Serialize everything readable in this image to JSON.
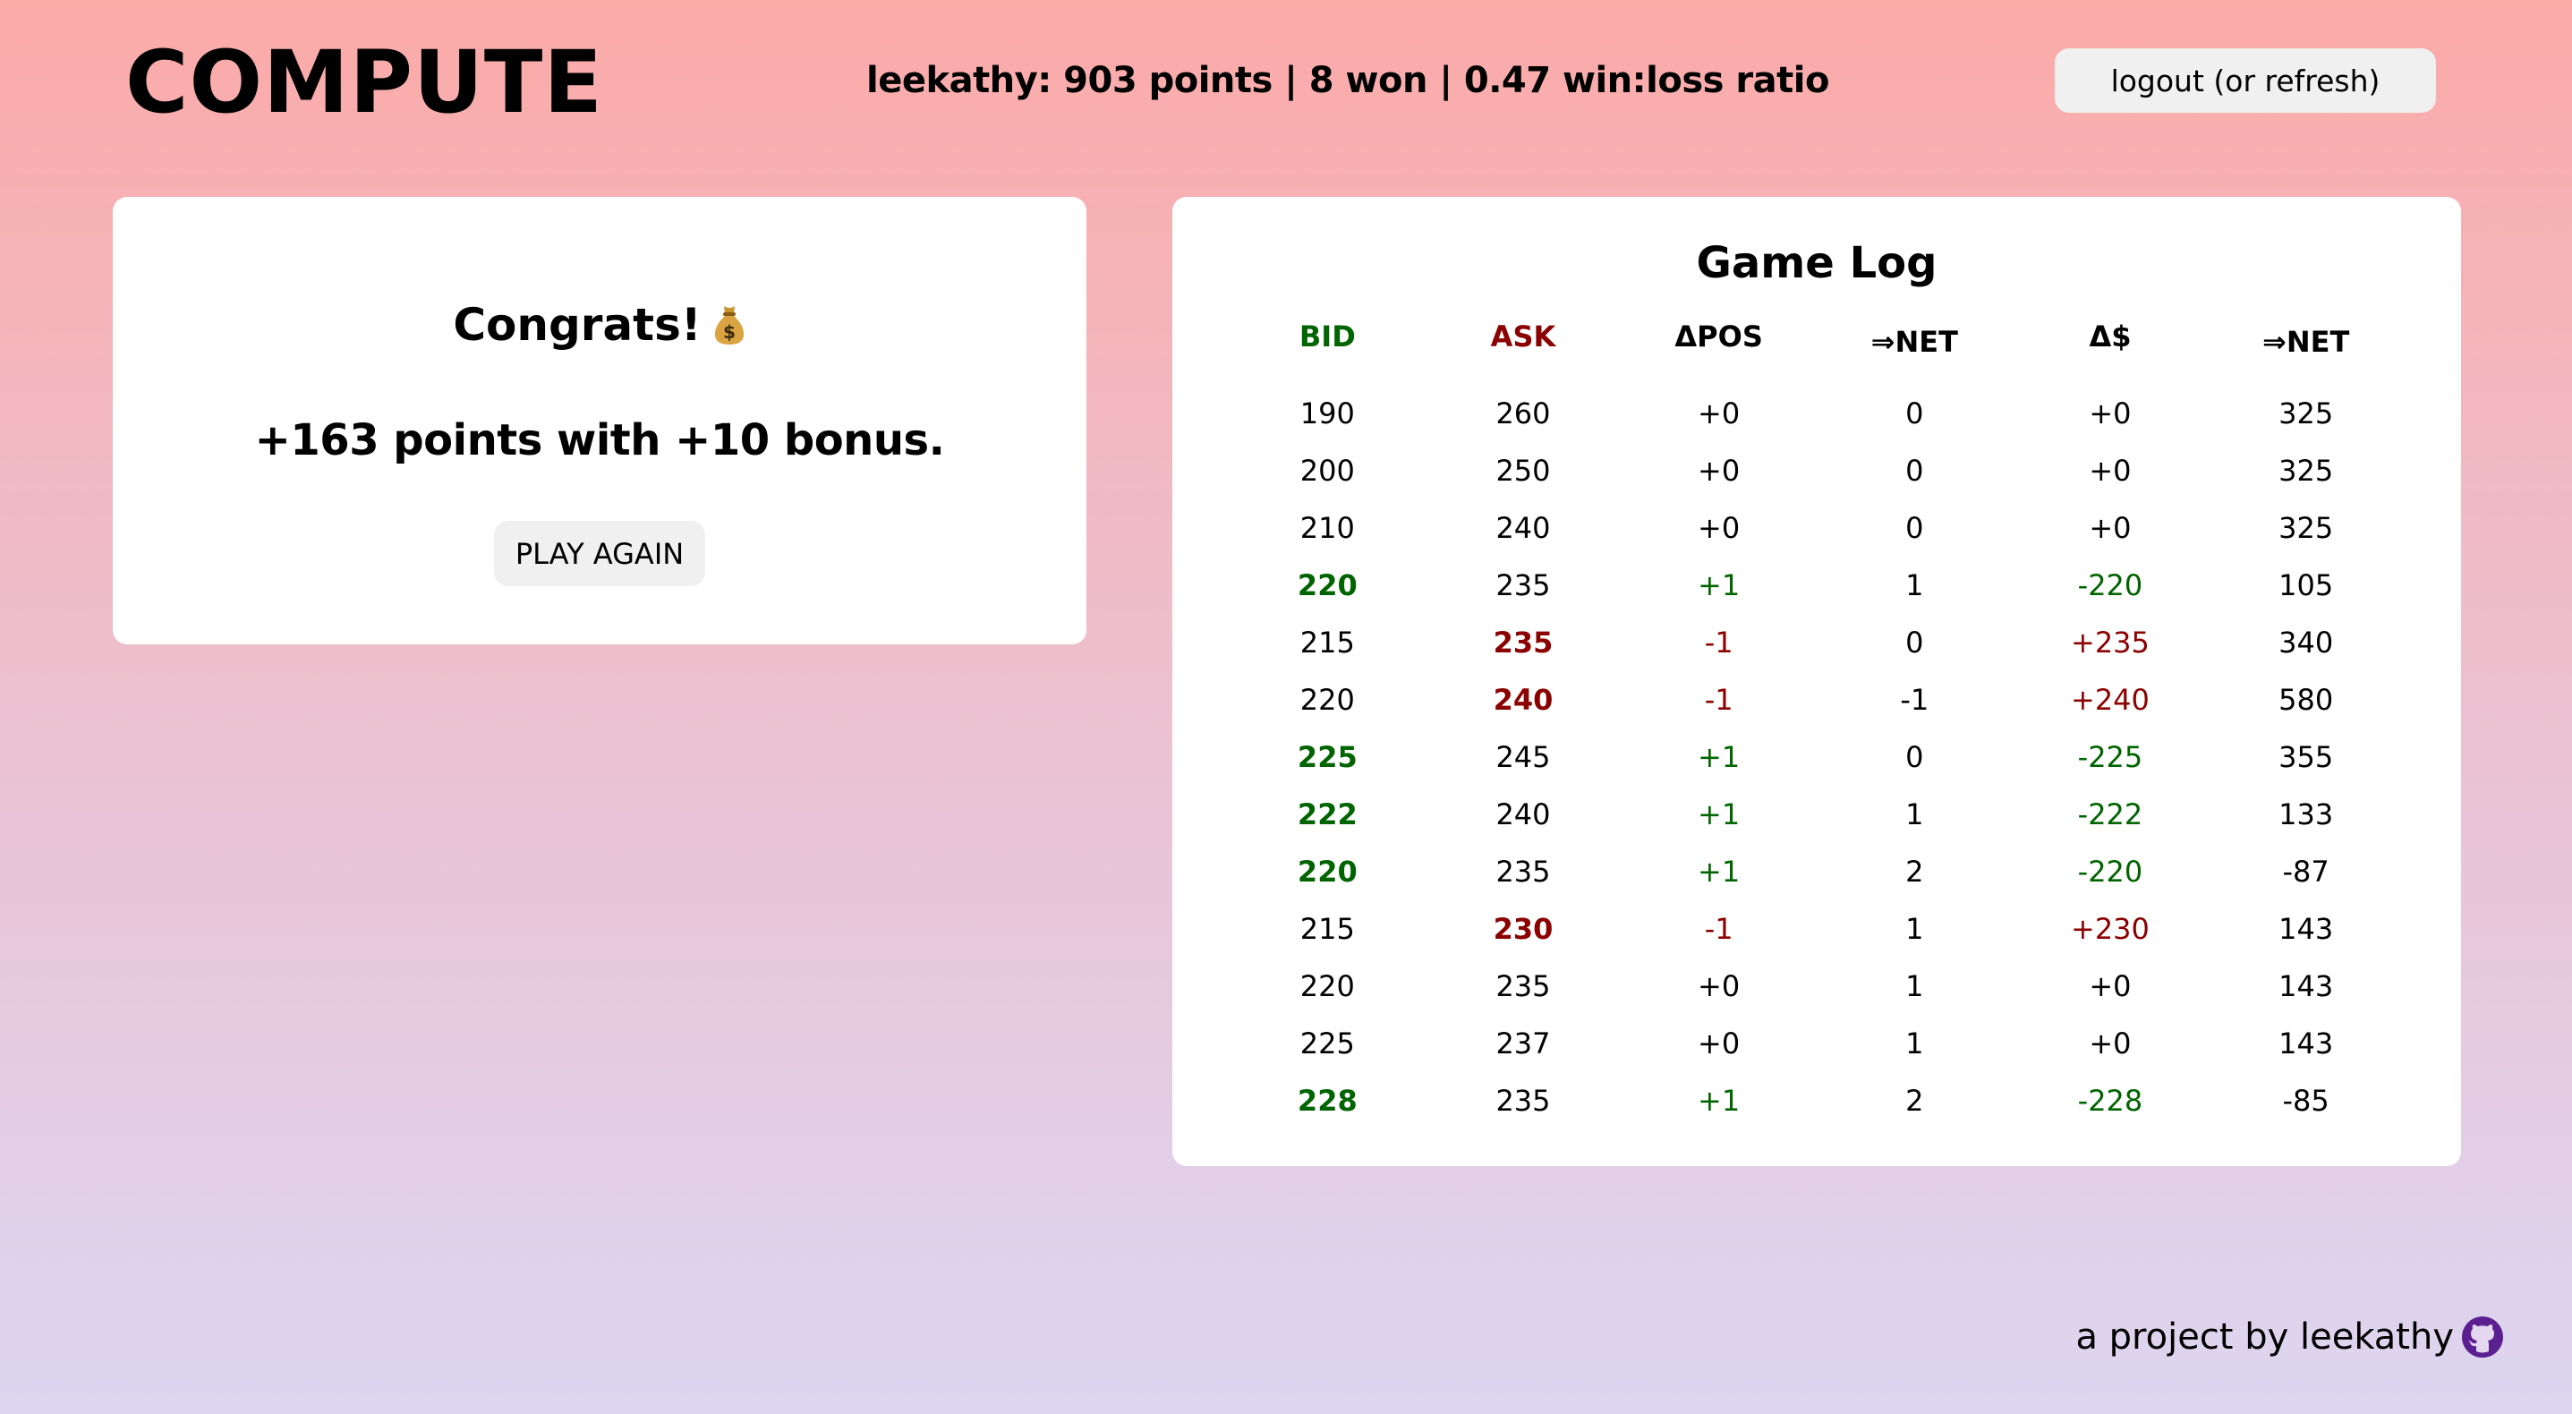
{
  "header": {
    "brand": "COMPUTE",
    "stats": "leekathy: 903 points | 8 won | 0.47 win:loss ratio",
    "logout_label": "logout (or refresh)"
  },
  "result": {
    "title": "Congrats!",
    "title_icon": "money-bag-icon",
    "points_text": "+163 points with +10 bonus.",
    "play_again_label": "PLAY AGAIN"
  },
  "game_log": {
    "title": "Game Log",
    "columns": [
      "BID",
      "ASK",
      "ΔPOS",
      "⇒NET",
      "Δ$",
      "⇒NET"
    ],
    "column_colors": {
      "bid": "#006400",
      "ask": "#8b0000"
    },
    "rows": [
      {
        "bid": "190",
        "ask": "260",
        "dpos": "+0",
        "net_pos": "0",
        "dcash": "+0",
        "net_cash": "325",
        "side": "none"
      },
      {
        "bid": "200",
        "ask": "250",
        "dpos": "+0",
        "net_pos": "0",
        "dcash": "+0",
        "net_cash": "325",
        "side": "none"
      },
      {
        "bid": "210",
        "ask": "240",
        "dpos": "+0",
        "net_pos": "0",
        "dcash": "+0",
        "net_cash": "325",
        "side": "none"
      },
      {
        "bid": "220",
        "ask": "235",
        "dpos": "+1",
        "net_pos": "1",
        "dcash": "-220",
        "net_cash": "105",
        "side": "bid"
      },
      {
        "bid": "215",
        "ask": "235",
        "dpos": "-1",
        "net_pos": "0",
        "dcash": "+235",
        "net_cash": "340",
        "side": "ask"
      },
      {
        "bid": "220",
        "ask": "240",
        "dpos": "-1",
        "net_pos": "-1",
        "dcash": "+240",
        "net_cash": "580",
        "side": "ask"
      },
      {
        "bid": "225",
        "ask": "245",
        "dpos": "+1",
        "net_pos": "0",
        "dcash": "-225",
        "net_cash": "355",
        "side": "bid"
      },
      {
        "bid": "222",
        "ask": "240",
        "dpos": "+1",
        "net_pos": "1",
        "dcash": "-222",
        "net_cash": "133",
        "side": "bid"
      },
      {
        "bid": "220",
        "ask": "235",
        "dpos": "+1",
        "net_pos": "2",
        "dcash": "-220",
        "net_cash": "-87",
        "side": "bid"
      },
      {
        "bid": "215",
        "ask": "230",
        "dpos": "-1",
        "net_pos": "1",
        "dcash": "+230",
        "net_cash": "143",
        "side": "ask"
      },
      {
        "bid": "220",
        "ask": "235",
        "dpos": "+0",
        "net_pos": "1",
        "dcash": "+0",
        "net_cash": "143",
        "side": "none"
      },
      {
        "bid": "225",
        "ask": "237",
        "dpos": "+0",
        "net_pos": "1",
        "dcash": "+0",
        "net_cash": "143",
        "side": "none"
      },
      {
        "bid": "228",
        "ask": "235",
        "dpos": "+1",
        "net_pos": "2",
        "dcash": "-228",
        "net_cash": "-85",
        "side": "bid"
      }
    ]
  },
  "footer": {
    "text": "a project by leekathy",
    "icon": "github-icon",
    "icon_color": "#5b1f8f"
  },
  "colors": {
    "gradient_top": "#fbaaa8",
    "gradient_bottom": "#dcd6f0",
    "buy_green": "#006400",
    "sell_red": "#8b0000"
  }
}
